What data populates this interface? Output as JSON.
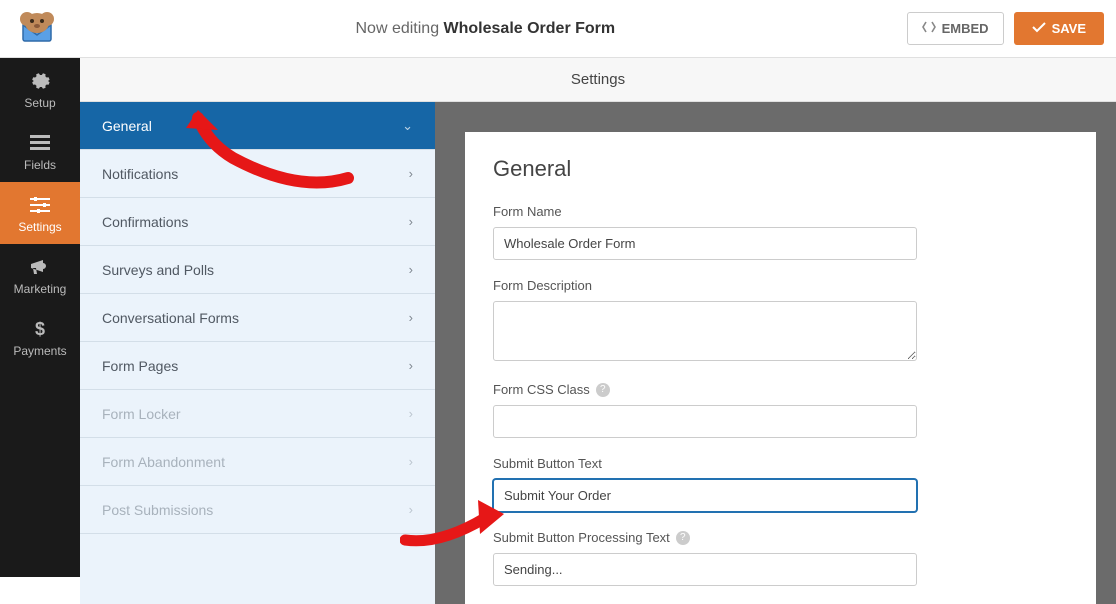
{
  "header": {
    "now_editing_prefix": "Now editing ",
    "form_title": "Wholesale Order Form",
    "embed_label": "EMBED",
    "save_label": "SAVE"
  },
  "leftnav": {
    "items": [
      {
        "label": "Setup",
        "icon": "gear"
      },
      {
        "label": "Fields",
        "icon": "list"
      },
      {
        "label": "Settings",
        "icon": "sliders"
      },
      {
        "label": "Marketing",
        "icon": "megaphone"
      },
      {
        "label": "Payments",
        "icon": "dollar"
      }
    ]
  },
  "section_title": "Settings",
  "settings_side": {
    "items": [
      {
        "label": "General",
        "expanded": true
      },
      {
        "label": "Notifications"
      },
      {
        "label": "Confirmations"
      },
      {
        "label": "Surveys and Polls"
      },
      {
        "label": "Conversational Forms"
      },
      {
        "label": "Form Pages"
      },
      {
        "label": "Form Locker",
        "disabled": true
      },
      {
        "label": "Form Abandonment",
        "disabled": true
      },
      {
        "label": "Post Submissions",
        "disabled": true
      }
    ]
  },
  "panel": {
    "heading": "General",
    "fields": {
      "form_name_label": "Form Name",
      "form_name_value": "Wholesale Order Form",
      "form_desc_label": "Form Description",
      "form_desc_value": "",
      "form_css_label": "Form CSS Class",
      "form_css_value": "",
      "submit_text_label": "Submit Button Text",
      "submit_text_value": "Submit Your Order",
      "submit_proc_label": "Submit Button Processing Text",
      "submit_proc_value": "Sending..."
    }
  }
}
